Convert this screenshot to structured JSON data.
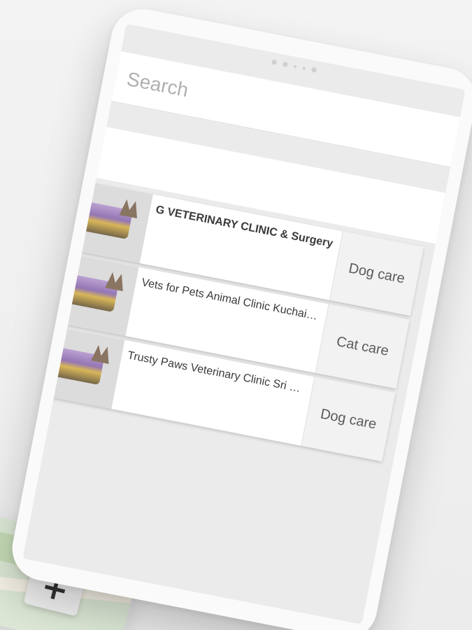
{
  "search": {
    "placeholder": "Search"
  },
  "clinics": [
    {
      "name": "G VETERINARY CLINIC & Surgery",
      "category": "Dog care"
    },
    {
      "name": "Vets for Pets Animal Clinic Kuchai La...",
      "category": "Cat care"
    },
    {
      "name": "Trusty Paws Veterinary Clinic Sri Ra...",
      "category": "Dog care"
    }
  ],
  "map": {
    "zoom_in_label": "+"
  },
  "icons": {
    "zoom": "plus-icon",
    "thumbnail": "clinic-logo-icon"
  },
  "colors": {
    "background": "#f0f0f0",
    "screen": "#ebebeb",
    "card": "#ffffff",
    "category_button": "#f2f2f2"
  }
}
